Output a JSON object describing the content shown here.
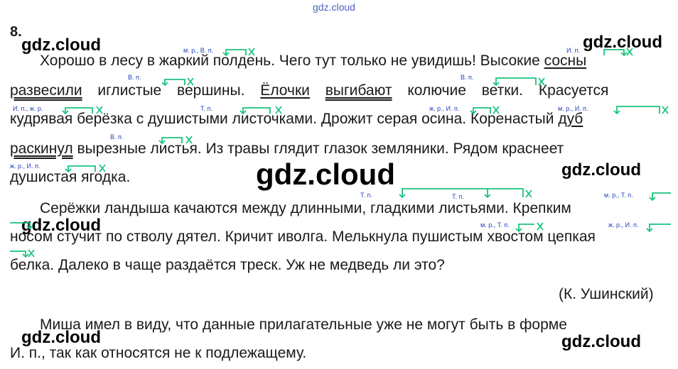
{
  "watermarks": {
    "top": "gdz.cloud",
    "label": "gdz.cloud"
  },
  "exercise_number": "8.",
  "lines": [
    "Хорошо в лесу в жаркий полдень. Чего тут только не увидишь! Высокие",
    "иглистые вершины.",
    "колючие ветки. Красуется",
    "кудрявая берёзка с душистыми листочками. Дрожит серая осина. Коренастый",
    "вырезные листья. Из травы глядит глазок земляники. Рядом краснеет",
    "душистая ягодка.",
    "Серёжки ландыша качаются между длинными, гладкими листьями. Крепким",
    "носом стучит по стволу дятел. Кричит иволга. Мелькнула пушистым хвостом цепкая",
    "белка. Далеко в чаще раздаётся треск. Уж не медведь ли это?",
    "(К. Ушинский)",
    "Миша имел в виду, что данные прилагательные уже не могут быть в форме",
    "И. п., так как относятся не к подлежащему."
  ],
  "words": {
    "sosny": "сосны",
    "razvesili": "развесили",
    "yolochki": "Ёлочки",
    "vygibayut": "выгибают",
    "dub": "дуб",
    "raskinul": "раскинул"
  },
  "tags": {
    "t1": "м. р., В. п.",
    "t2": "И. п.",
    "t3": "В. п.",
    "t4": "В. п.",
    "t5": "И. п., ж. р.",
    "t6": "Т. п.",
    "t7": "ж. р., И. п.",
    "t8": "м. р., И. п.",
    "t9": "В. п.",
    "t10": "ж. р., И. п.",
    "t11": "Т. п.",
    "t12": "Т. п.",
    "t13": "м. р., Т. п.",
    "t14": "м. р., Т. п.",
    "t15": "ж. р., И. п."
  },
  "colors": {
    "mark": "#19c37d",
    "tag": "#1f3fbf",
    "text": "#1a1a1a"
  }
}
